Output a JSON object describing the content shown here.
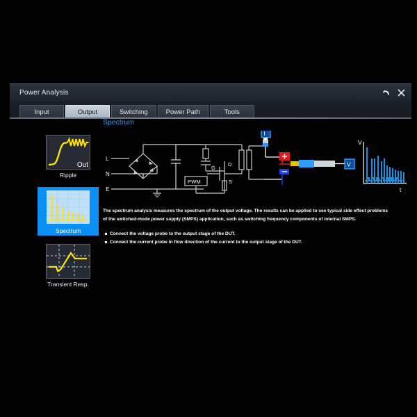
{
  "window": {
    "title": "Power Analysis",
    "buttons": [
      {
        "name": "undo-button",
        "label": "↶"
      },
      {
        "name": "close-button",
        "label": "✕"
      }
    ]
  },
  "tabs": [
    {
      "label": "Input",
      "active": false
    },
    {
      "label": "Output",
      "active": true
    },
    {
      "label": "Switching",
      "active": false
    },
    {
      "label": "Power Path",
      "active": false
    },
    {
      "label": "Tools",
      "active": false
    }
  ],
  "sidebar": {
    "items": [
      {
        "label": "Ripple",
        "selected": false,
        "badge": "Out"
      },
      {
        "label": "Spectrum",
        "selected": true,
        "badge": ""
      },
      {
        "label": "Transient Resp.",
        "selected": false,
        "badge": ""
      }
    ]
  },
  "main": {
    "heading": "Spectrum",
    "description": "The spectrum analysis measures the spectrum of the output voltage. The results can be applied to see typical side effect problems of the switched-mode power supply (SMPS) application, such as switching frequency components of internal SMPS.",
    "bullets": [
      "Connect the voltage probe to the output stage of the DUT.",
      "Connect the current probe in flow direction of the current to the output stage of the DUT."
    ]
  },
  "diagram": {
    "input_labels": [
      "L",
      "N",
      "E"
    ],
    "component_labels": [
      "D",
      "G",
      "S"
    ],
    "pwm_label": "PWM",
    "probe_labels": [
      "I",
      "V"
    ],
    "terminal_labels": [
      "+",
      "-"
    ],
    "graph_axis_labels": {
      "y": "V",
      "x": "t"
    }
  },
  "colors": {
    "accent_blue": "#2f9bff",
    "selection_blue": "#0a8ff5",
    "waveform_yellow": "#ffe000",
    "spectrum_blue": "#1f8fe0",
    "positive_red": "#e01b1b",
    "negative_blue": "#1b3fe0",
    "background": "#000000"
  }
}
